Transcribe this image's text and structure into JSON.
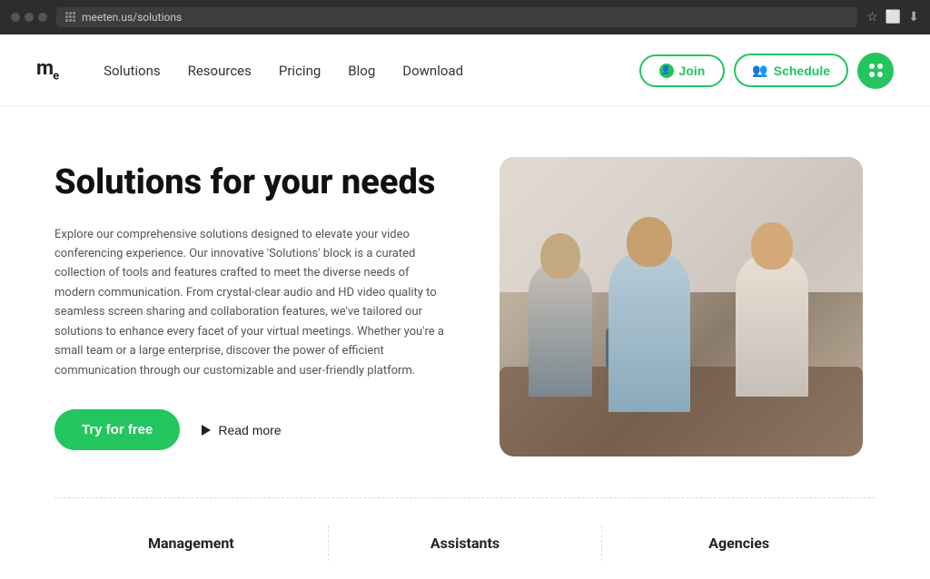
{
  "browser": {
    "url": "meeten.us/solutions",
    "favicon": "⚡"
  },
  "navbar": {
    "logo": "m",
    "logo_sub": "e",
    "links": [
      {
        "id": "solutions",
        "label": "Solutions"
      },
      {
        "id": "resources",
        "label": "Resources"
      },
      {
        "id": "pricing",
        "label": "Pricing"
      },
      {
        "id": "blog",
        "label": "Blog"
      },
      {
        "id": "download",
        "label": "Download"
      }
    ],
    "btn_join": "Join",
    "btn_schedule": "Schedule",
    "btn_grid_aria": "Apps menu"
  },
  "hero": {
    "title": "Solutions for your needs",
    "description": "Explore our comprehensive solutions designed to elevate your video conferencing experience. Our innovative 'Solutions' block is a curated collection of tools and features crafted to meet the diverse needs of modern communication. From crystal-clear audio and HD video quality to seamless screen sharing and collaboration features, we've tailored our solutions to enhance every facet of your virtual meetings. Whether you're a small team or a large enterprise, discover the power of efficient communication through our customizable and user-friendly platform.",
    "btn_try": "Try for free",
    "btn_readmore": "Read more",
    "image_alt": "People in a meeting looking at a tablet"
  },
  "bottom_section": {
    "items": [
      {
        "id": "management",
        "label": "Management"
      },
      {
        "id": "assistants",
        "label": "Assistants"
      },
      {
        "id": "agencies",
        "label": "Agencies"
      }
    ]
  },
  "colors": {
    "green": "#22c55e",
    "dark": "#111111",
    "text": "#555555",
    "border": "#dddddd"
  }
}
